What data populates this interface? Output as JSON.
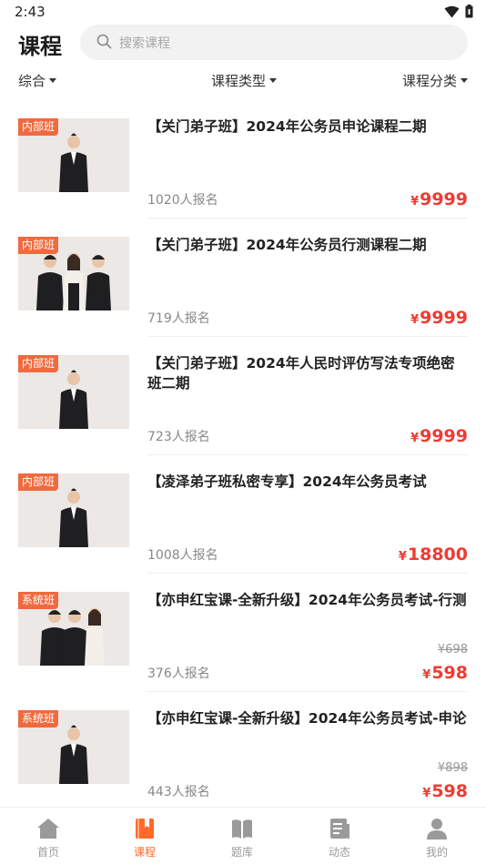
{
  "status_bar": {
    "time": "2:43"
  },
  "header": {
    "title": "课程",
    "search_placeholder": "搜索课程"
  },
  "filters": [
    {
      "label": "综合"
    },
    {
      "label": "课程类型"
    },
    {
      "label": "课程分类"
    }
  ],
  "courses": [
    {
      "badge": "内部班",
      "title": "【关门弟子班】2024年公务员申论课程二期",
      "enrolled": "1020人报名",
      "currency": "¥",
      "price": "9999",
      "original_price": ""
    },
    {
      "badge": "内部班",
      "title": "【关门弟子班】2024年公务员行测课程二期",
      "enrolled": "719人报名",
      "currency": "¥",
      "price": "9999",
      "original_price": ""
    },
    {
      "badge": "内部班",
      "title": "【关门弟子班】2024年人民时评仿写法专项绝密班二期",
      "enrolled": "723人报名",
      "currency": "¥",
      "price": "9999",
      "original_price": ""
    },
    {
      "badge": "内部班",
      "title": "【凌泽弟子班私密专享】2024年公务员考试",
      "enrolled": "1008人报名",
      "currency": "¥",
      "price": "18800",
      "original_price": ""
    },
    {
      "badge": "系统班",
      "title": "【亦申红宝课-全新升级】2024年公务员考试-行测",
      "enrolled": "376人报名",
      "currency": "¥",
      "price": "598",
      "original_price": "¥698"
    },
    {
      "badge": "系统班",
      "title": "【亦申红宝课-全新升级】2024年公务员考试-申论",
      "enrolled": "443人报名",
      "currency": "¥",
      "price": "598",
      "original_price": "¥898"
    }
  ],
  "tabs": [
    {
      "label": "首页",
      "icon": "home-icon",
      "active": false
    },
    {
      "label": "课程",
      "icon": "course-icon",
      "active": true
    },
    {
      "label": "题库",
      "icon": "book-icon",
      "active": false
    },
    {
      "label": "动态",
      "icon": "news-icon",
      "active": false
    },
    {
      "label": "我的",
      "icon": "profile-icon",
      "active": false
    }
  ],
  "colors": {
    "accent": "#ff6a2a",
    "price": "#f03a32",
    "badge": "#f06a3f"
  }
}
